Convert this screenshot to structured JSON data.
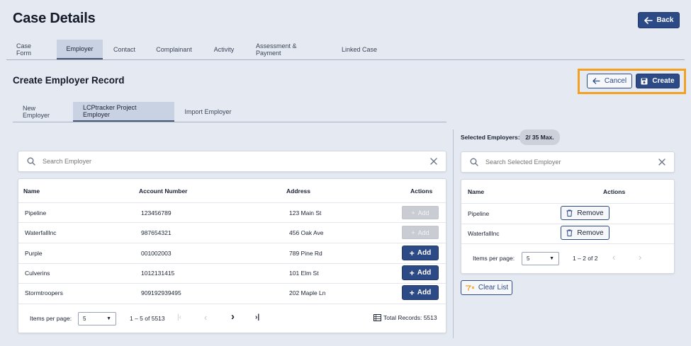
{
  "page": {
    "title": "Case Details",
    "back_label": "Back"
  },
  "case_tabs": [
    "Case Form",
    "Employer",
    "Contact",
    "Complainant",
    "Activity",
    "Assessment & Payment",
    "Linked Case"
  ],
  "section": {
    "title": "Create Employer Record",
    "cancel_label": "Cancel",
    "create_label": "Create"
  },
  "sub_tabs": [
    "New Employer",
    "LCPtracker Project Employer",
    "Import Employer"
  ],
  "employer_search": {
    "placeholder": "Search Employer"
  },
  "employer_table": {
    "headers": {
      "name": "Name",
      "account": "Account Number",
      "address": "Address",
      "actions": "Actions"
    },
    "rows": [
      {
        "name": "Pipeline",
        "account": "123456789",
        "address": "123 Main St",
        "action": "Add",
        "enabled": false
      },
      {
        "name": "WaterfallInc",
        "account": "987654321",
        "address": "456 Oak Ave",
        "action": "Add",
        "enabled": false
      },
      {
        "name": "Purple",
        "account": "001002003",
        "address": "789 Pine Rd",
        "action": "Add",
        "enabled": true
      },
      {
        "name": "Culverins",
        "account": "1012131415",
        "address": "101 Elm St",
        "action": "Add",
        "enabled": true
      },
      {
        "name": "Stormtroopers",
        "account": "909192939495",
        "address": "202 Maple Ln",
        "action": "Add",
        "enabled": true
      }
    ],
    "pager": {
      "label": "Items per page:",
      "page_size": "5",
      "range": "1 – 5 of 5513",
      "total": "Total Records: 5513"
    }
  },
  "selected": {
    "label": "Selected Employers:",
    "count_badge": "2/ 35 Max.",
    "search_placeholder": "Search Selected Employer",
    "headers": {
      "name": "Name",
      "actions": "Actions"
    },
    "rows": [
      {
        "name": "Pipeline",
        "action": "Remove"
      },
      {
        "name": "WaterfallInc",
        "action": "Remove"
      }
    ],
    "pager": {
      "label": "Items per page:",
      "page_size": "5",
      "range": "1 – 2 of 2"
    },
    "clear_label": "Clear List"
  },
  "colors": {
    "primary": "#2c4a86",
    "background": "#e4e9f2",
    "highlight": "#f4a020",
    "disabled": "#c9ccd2"
  }
}
